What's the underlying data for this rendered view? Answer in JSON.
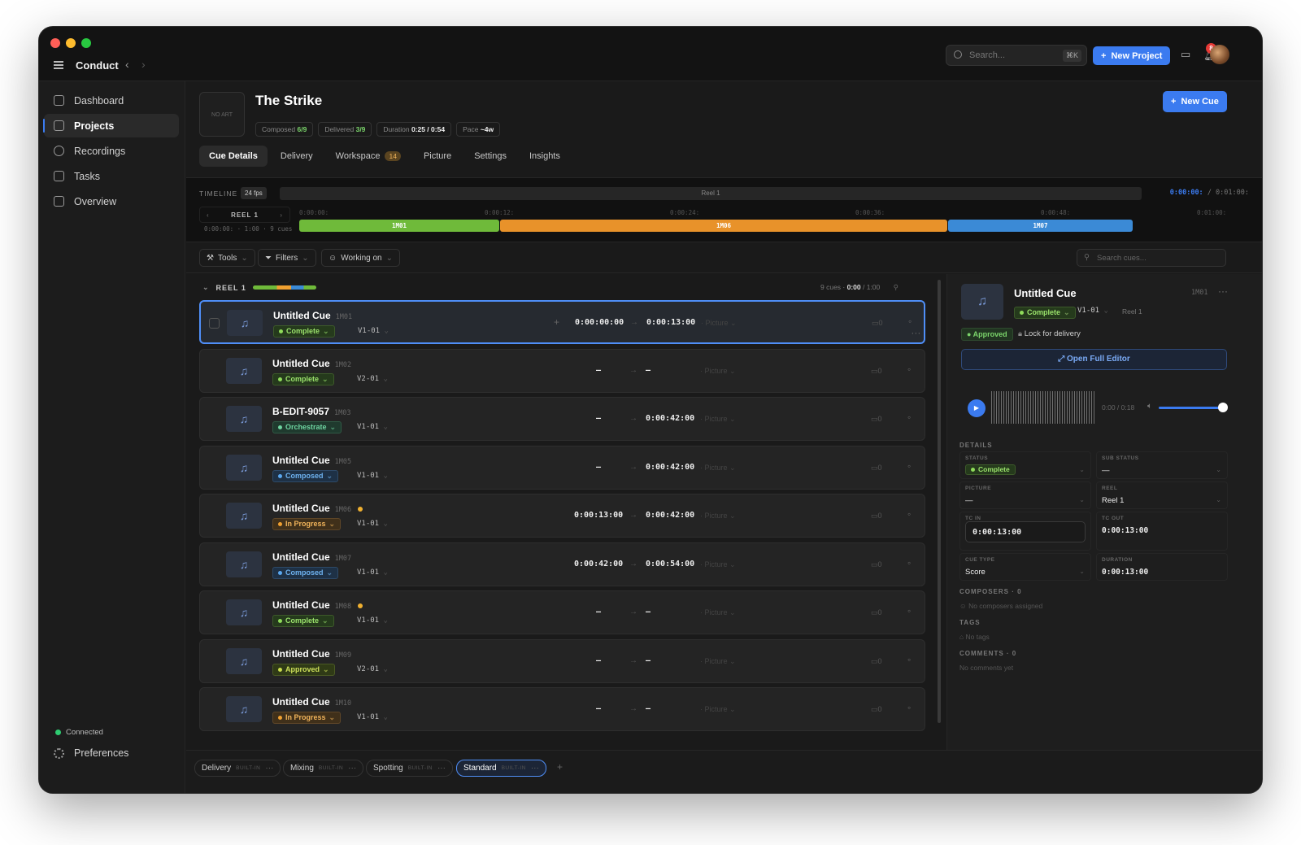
{
  "app": {
    "title": "Conduct"
  },
  "header": {
    "search_placeholder": "Search...",
    "search_kbd": "⌘K",
    "new_project_label": "New Project",
    "notification_count": "8"
  },
  "sidebar": {
    "items": [
      {
        "label": "Dashboard"
      },
      {
        "label": "Projects"
      },
      {
        "label": "Recordings"
      },
      {
        "label": "Tasks"
      },
      {
        "label": "Overview"
      }
    ],
    "connection_status": "Connected",
    "preferences_label": "Preferences"
  },
  "project": {
    "art_placeholder": "NO ART",
    "title": "The Strike",
    "new_cue_label": "New Cue",
    "stats": [
      {
        "label": "Composed",
        "value": "6/9"
      },
      {
        "label": "Delivered",
        "value": "3/9"
      },
      {
        "label": "Duration",
        "value": "0:25 / 0:54"
      },
      {
        "label": "Pace",
        "value": "~4w"
      }
    ],
    "tabs": [
      {
        "label": "Cue Details"
      },
      {
        "label": "Delivery"
      },
      {
        "label": "Workspace",
        "badge": "14"
      },
      {
        "label": "Picture"
      },
      {
        "label": "Settings"
      },
      {
        "label": "Insights"
      }
    ]
  },
  "timeline": {
    "label": "TIMELINE",
    "fps": "24 fps",
    "reel_bar_label": "Reel 1",
    "current_tc": "0:00:00:",
    "total_tc": "/ 0:01:00:",
    "reel_nav_label": "REEL 1",
    "reel_sub": "0:00:00: · 1:00 · 9 cues",
    "ticks": [
      "0:00:00:",
      "0:00:12:",
      "0:00:24:",
      "0:00:36:",
      "0:00:48:",
      "0:01:00:"
    ],
    "blocks": [
      {
        "label": "1M01",
        "start": 0,
        "end": 13,
        "color": "#6fba3a"
      },
      {
        "label": "1M06",
        "start": 13,
        "end": 42,
        "color": "#e8922a"
      },
      {
        "label": "1M07",
        "start": 42,
        "end": 54,
        "color": "#3b8ad6"
      }
    ],
    "range": [
      0,
      60
    ]
  },
  "filters": {
    "tools_label": "Tools",
    "filters_label": "Filters",
    "working_on_label": "Working on",
    "search_placeholder": "Search cues..."
  },
  "reel": {
    "title": "REEL 1",
    "cue_count": "9 cues",
    "duration_current": "0:00",
    "duration_total": "/ 1:00"
  },
  "cues": [
    {
      "name": "Untitled Cue",
      "code": "1M01",
      "status": "Complete",
      "status_class": "st-complete",
      "version": "V1-01",
      "tc_in": "0:00:00:00",
      "tc_out": "0:00:13:00",
      "picture": "Picture",
      "comments": "0",
      "dot": false
    },
    {
      "name": "Untitled Cue",
      "code": "1M02",
      "status": "Complete",
      "status_class": "st-complete",
      "version": "V2-01",
      "tc_in": "–",
      "tc_out": "–",
      "picture": "Picture",
      "comments": "0",
      "dot": false
    },
    {
      "name": "B-EDIT-9057",
      "code": "1M03",
      "status": "Orchestrate",
      "status_class": "st-orch",
      "version": "V1-01",
      "tc_in": "–",
      "tc_out": "0:00:42:00",
      "picture": "Picture",
      "comments": "0",
      "dot": false
    },
    {
      "name": "Untitled Cue",
      "code": "1M05",
      "status": "Composed",
      "status_class": "st-composed",
      "version": "V1-01",
      "tc_in": "–",
      "tc_out": "0:00:42:00",
      "picture": "Picture",
      "comments": "0",
      "dot": false
    },
    {
      "name": "Untitled Cue",
      "code": "1M06",
      "status": "In Progress",
      "status_class": "st-progress",
      "version": "V1-01",
      "tc_in": "0:00:13:00",
      "tc_out": "0:00:42:00",
      "picture": "Picture",
      "comments": "0",
      "dot": true
    },
    {
      "name": "Untitled Cue",
      "code": "1M07",
      "status": "Composed",
      "status_class": "st-composed",
      "version": "V1-01",
      "tc_in": "0:00:42:00",
      "tc_out": "0:00:54:00",
      "picture": "Picture",
      "comments": "0",
      "dot": false
    },
    {
      "name": "Untitled Cue",
      "code": "1M08",
      "status": "Complete",
      "status_class": "st-complete",
      "version": "V1-01",
      "tc_in": "–",
      "tc_out": "–",
      "picture": "Picture",
      "comments": "0",
      "dot": true
    },
    {
      "name": "Untitled Cue",
      "code": "1M09",
      "status": "Approved",
      "status_class": "st-approved",
      "version": "V2-01",
      "tc_in": "–",
      "tc_out": "–",
      "picture": "Picture",
      "comments": "0",
      "dot": false
    },
    {
      "name": "Untitled Cue",
      "code": "1M10",
      "status": "In Progress",
      "status_class": "st-progress",
      "version": "V1-01",
      "tc_in": "–",
      "tc_out": "–",
      "picture": "Picture",
      "comments": "0",
      "dot": false
    }
  ],
  "panel": {
    "title": "Untitled Cue",
    "code": "1M01",
    "status": "Complete",
    "version": "V1-01",
    "reel": "Reel 1",
    "approved_label": "Approved",
    "lock_label": "Lock for delivery",
    "open_editor_label": "Open Full Editor",
    "player_time": "0:00 / 0:18",
    "volume": 1.0,
    "details_label": "DETAILS",
    "fields": {
      "status_label": "STATUS",
      "status_value": "Complete",
      "sub_status_label": "SUB STATUS",
      "sub_status_value": "—",
      "picture_label": "PICTURE",
      "picture_value": "—",
      "reel_label": "REEL",
      "reel_value": "Reel 1",
      "tc_in_label": "TC IN",
      "tc_in_value": "0:00:13:00",
      "tc_out_label": "TC OUT",
      "tc_out_value": "0:00:13:00",
      "cue_type_label": "CUE TYPE",
      "cue_type_value": "Score",
      "duration_label": "DURATION",
      "duration_value": "0:00:13:00"
    },
    "composers_label": "COMPOSERS · 0",
    "composers_empty": "No composers assigned",
    "tags_label": "TAGS",
    "tags_empty": "No tags",
    "comments_label": "COMMENTS · 0",
    "comments_empty": "No comments yet"
  },
  "views": [
    {
      "label": "Delivery",
      "tag": "BUILT-IN"
    },
    {
      "label": "Mixing",
      "tag": "BUILT-IN"
    },
    {
      "label": "Spotting",
      "tag": "BUILT-IN"
    },
    {
      "label": "Standard",
      "tag": "BUILT-IN"
    }
  ],
  "colors": {
    "accent": "#3b7bf0",
    "background": "#1a1a1a"
  }
}
